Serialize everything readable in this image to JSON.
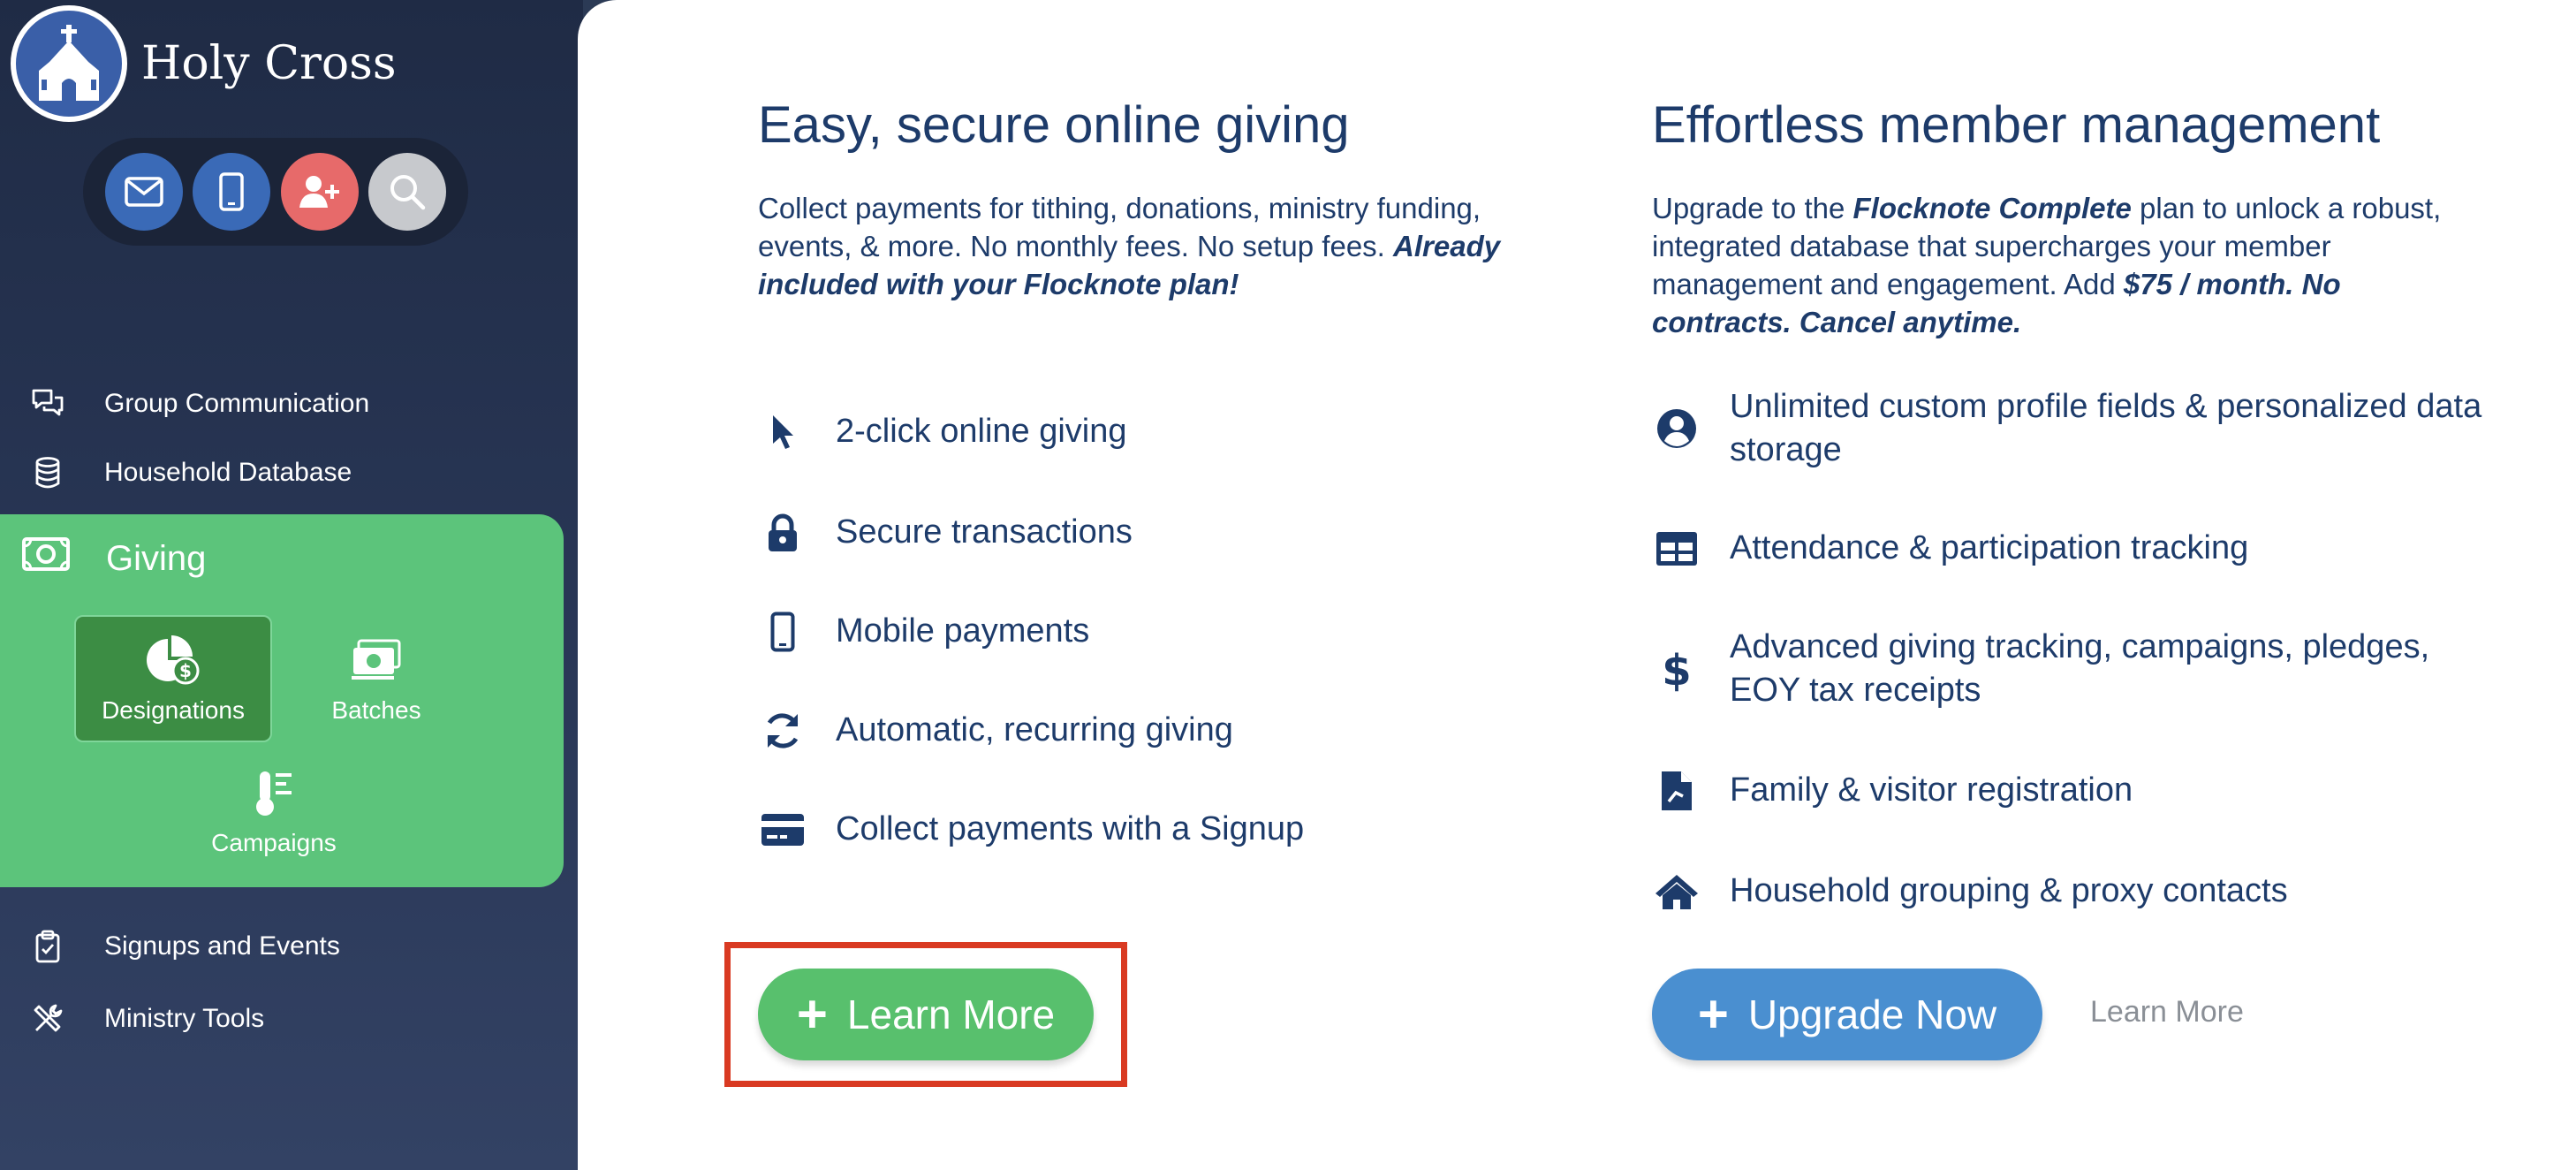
{
  "brand": {
    "name": "Holy Cross"
  },
  "quick_actions": [
    {
      "icon": "mail-icon"
    },
    {
      "icon": "mobile-icon"
    },
    {
      "icon": "add-person-icon"
    },
    {
      "icon": "search-icon"
    }
  ],
  "nav": {
    "group_communication": "Group Communication",
    "household_database": "Household Database",
    "giving": "Giving",
    "giving_sub": {
      "designations": "Designations",
      "batches": "Batches",
      "campaigns": "Campaigns"
    },
    "signups_events": "Signups and Events",
    "ministry_tools": "Ministry Tools"
  },
  "left_section": {
    "title": "Easy, secure online giving",
    "intro_plain": "Collect payments for tithing, donations, ministry funding, events, & more. No monthly fees. No setup fees. ",
    "intro_emph": "Already included with your Flocknote plan!",
    "features": [
      {
        "icon": "cursor-icon",
        "text": "2-click online giving"
      },
      {
        "icon": "lock-icon",
        "text": "Secure transactions"
      },
      {
        "icon": "mobile-icon",
        "text": "Mobile payments"
      },
      {
        "icon": "refresh-icon",
        "text": "Automatic, recurring giving"
      },
      {
        "icon": "credit-card-icon",
        "text": "Collect payments with a Signup"
      }
    ],
    "button": "Learn More"
  },
  "right_section": {
    "title": "Effortless member management",
    "intro_a": "Upgrade to the ",
    "intro_plan": "Flocknote Complete",
    "intro_b": " plan to unlock a robust, integrated database that supercharges your member management and engagement. Add ",
    "intro_emph": "$75 / month. No contracts. Cancel anytime.",
    "features": [
      {
        "icon": "user-circle-icon",
        "text": "Unlimited custom profile fields & personalized data storage"
      },
      {
        "icon": "table-icon",
        "text": "Attendance & participation tracking"
      },
      {
        "icon": "dollar-icon",
        "text": "Advanced giving tracking, campaigns, pledges, EOY tax receipts"
      },
      {
        "icon": "file-signature-icon",
        "text": "Family & visitor registration"
      },
      {
        "icon": "home-icon",
        "text": "Household grouping & proxy contacts"
      }
    ],
    "upgrade_button": "Upgrade Now",
    "learn_link": "Learn More"
  },
  "colors": {
    "sidebar": "#2b3a55",
    "giving_green": "#5cc47b",
    "button_green": "#58c06d",
    "button_blue": "#4a8fd0",
    "text_navy": "#1d3b6a",
    "highlight_red": "#d93a22"
  }
}
